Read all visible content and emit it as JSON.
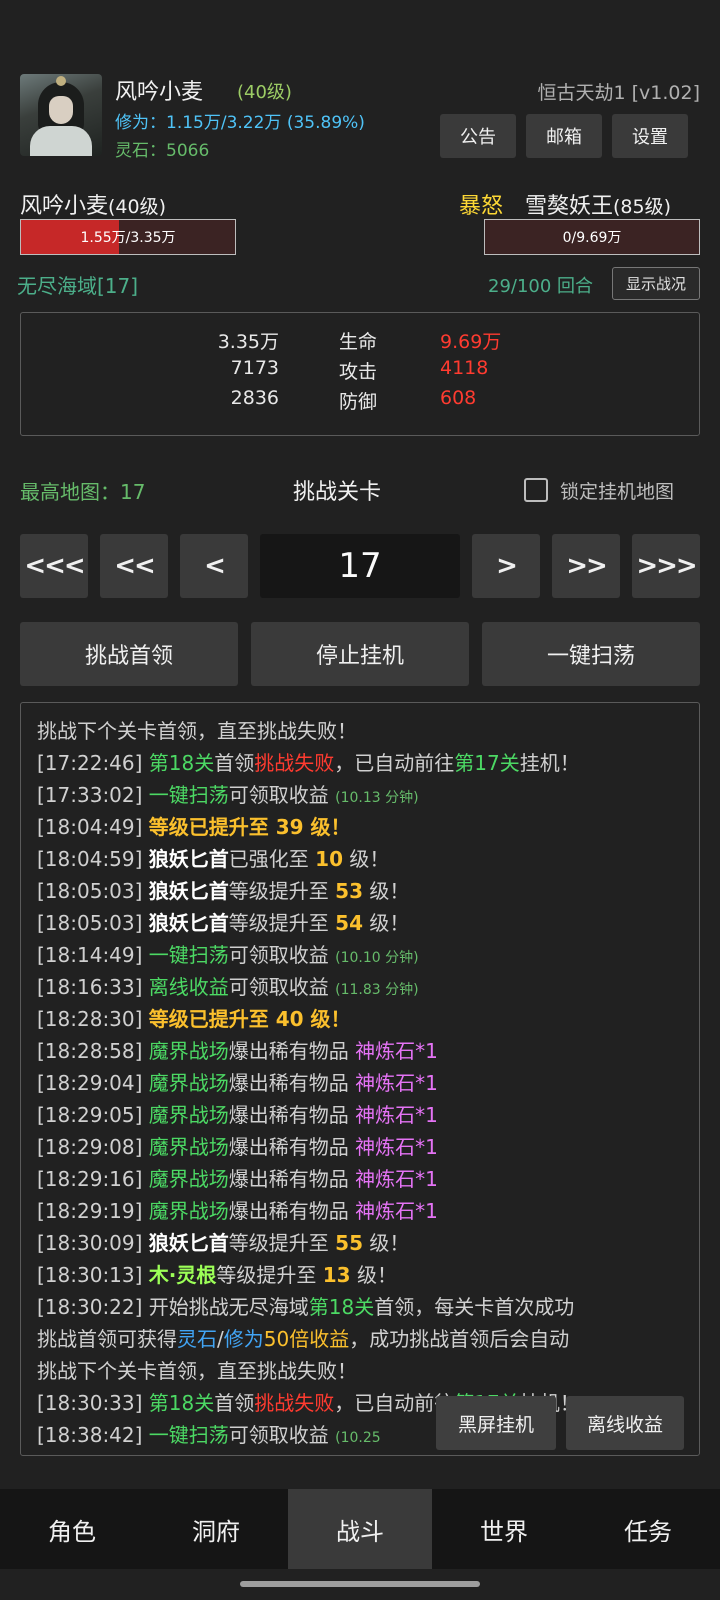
{
  "player": {
    "name": "风吟小麦",
    "level": "(40级)",
    "xiuwei": "修为：1.15万/3.22万 (35.89%)",
    "lingshi": "灵石：5066"
  },
  "game_title": "恒古天劫1 [v1.02]",
  "top_buttons": [
    "公告",
    "邮箱",
    "设置"
  ],
  "battle": {
    "left_name": "风吟小麦",
    "left_level": "(40级)",
    "left_hp": "1.55万/3.35万",
    "left_hp_fraction": 0.46,
    "rage": "暴怒",
    "right_name": "雪獒妖王",
    "right_level": "(85级)",
    "right_hp": "0/9.69万",
    "right_hp_fraction": 0,
    "map": "无尽海域[17]",
    "rounds": "29/100 回合",
    "show_button": "显示战况"
  },
  "stats": [
    {
      "left": "3.35万",
      "label": "生命",
      "right": "9.69万"
    },
    {
      "left": "7173",
      "label": "攻击",
      "right": "4118"
    },
    {
      "left": "2836",
      "label": "防御",
      "right": "608"
    }
  ],
  "level_select": {
    "highest": "最高地图：17",
    "title": "挑战关卡",
    "lock_label": "锁定挂机地图",
    "current": "17",
    "nav": [
      "<<<",
      "<<",
      "<",
      ">",
      ">>",
      ">>>"
    ]
  },
  "actions": [
    "挑战首领",
    "停止挂机",
    "一键扫荡"
  ],
  "log": {
    "l0": "挑战下个关卡首领，直至挑战失败！",
    "l1": {
      "t": "[17:22:46]",
      "a": "第18关",
      "b": "首领",
      "c": "挑战失败",
      "d": "，已自动前往",
      "e": "第17关",
      "f": "挂机！"
    },
    "l2": {
      "t": "[17:33:02]",
      "a": "一键扫荡",
      "b": "可领取收益",
      "c": "(10.13 分钟)"
    },
    "l3": {
      "t": "[18:04:49]",
      "a": "等级已提升至 39 级！"
    },
    "l4": {
      "t": "[18:04:59]",
      "a": "狼妖匕首",
      "b": "已强化至",
      "c": "10",
      "d": "级！"
    },
    "l5": {
      "t": "[18:05:03]",
      "a": "狼妖匕首",
      "b": "等级提升至",
      "c": "53",
      "d": "级！"
    },
    "l6": {
      "t": "[18:05:03]",
      "a": "狼妖匕首",
      "b": "等级提升至",
      "c": "54",
      "d": "级！"
    },
    "l7": {
      "t": "[18:14:49]",
      "a": "一键扫荡",
      "b": "可领取收益",
      "c": "(10.10 分钟)"
    },
    "l8": {
      "t": "[18:16:33]",
      "a": "离线收益",
      "b": "可领取收益",
      "c": "(11.83 分钟)"
    },
    "l9": {
      "t": "[18:28:30]",
      "a": "等级已提升至 40 级！"
    },
    "l10": {
      "t": "[18:28:58]",
      "a": "魔界战场",
      "b": "爆出稀有物品",
      "c": "神炼石*1"
    },
    "l11": {
      "t": "[18:29:04]",
      "a": "魔界战场",
      "b": "爆出稀有物品",
      "c": "神炼石*1"
    },
    "l12": {
      "t": "[18:29:05]",
      "a": "魔界战场",
      "b": "爆出稀有物品",
      "c": "神炼石*1"
    },
    "l13": {
      "t": "[18:29:08]",
      "a": "魔界战场",
      "b": "爆出稀有物品",
      "c": "神炼石*1"
    },
    "l14": {
      "t": "[18:29:16]",
      "a": "魔界战场",
      "b": "爆出稀有物品",
      "c": "神炼石*1"
    },
    "l15": {
      "t": "[18:29:19]",
      "a": "魔界战场",
      "b": "爆出稀有物品",
      "c": "神炼石*1"
    },
    "l16": {
      "t": "[18:30:09]",
      "a": "狼妖匕首",
      "b": "等级提升至",
      "c": "55",
      "d": "级！"
    },
    "l17": {
      "t": "[18:30:13]",
      "a": "木·灵根",
      "b": "等级提升至",
      "c": "13",
      "d": "级！"
    },
    "l18": {
      "t": "[18:30:22]",
      "a": "开始挑战无尽海域",
      "b": "第18关",
      "c": "首领，每关卡首次成功"
    },
    "l19": {
      "a": "挑战首领可获得",
      "b": "灵石",
      "c": "/",
      "d": "修为",
      "e": "50倍收益",
      "f": "，成功挑战首领后会自动"
    },
    "l20": "挑战下个关卡首领，直至挑战失败！",
    "l21": {
      "t": "[18:30:33]",
      "a": "第18关",
      "b": "首领",
      "c": "挑战失败",
      "d": "，已自动前往",
      "e": "第17关",
      "f": "挂机！"
    },
    "l22": {
      "t": "[18:38:42]",
      "a": "一键扫荡",
      "b": "可领取收益",
      "c": "(10.25"
    }
  },
  "float_buttons": [
    "黑屏挂机",
    "离线收益"
  ],
  "tabs": [
    "角色",
    "洞府",
    "战斗",
    "世界",
    "任务"
  ]
}
